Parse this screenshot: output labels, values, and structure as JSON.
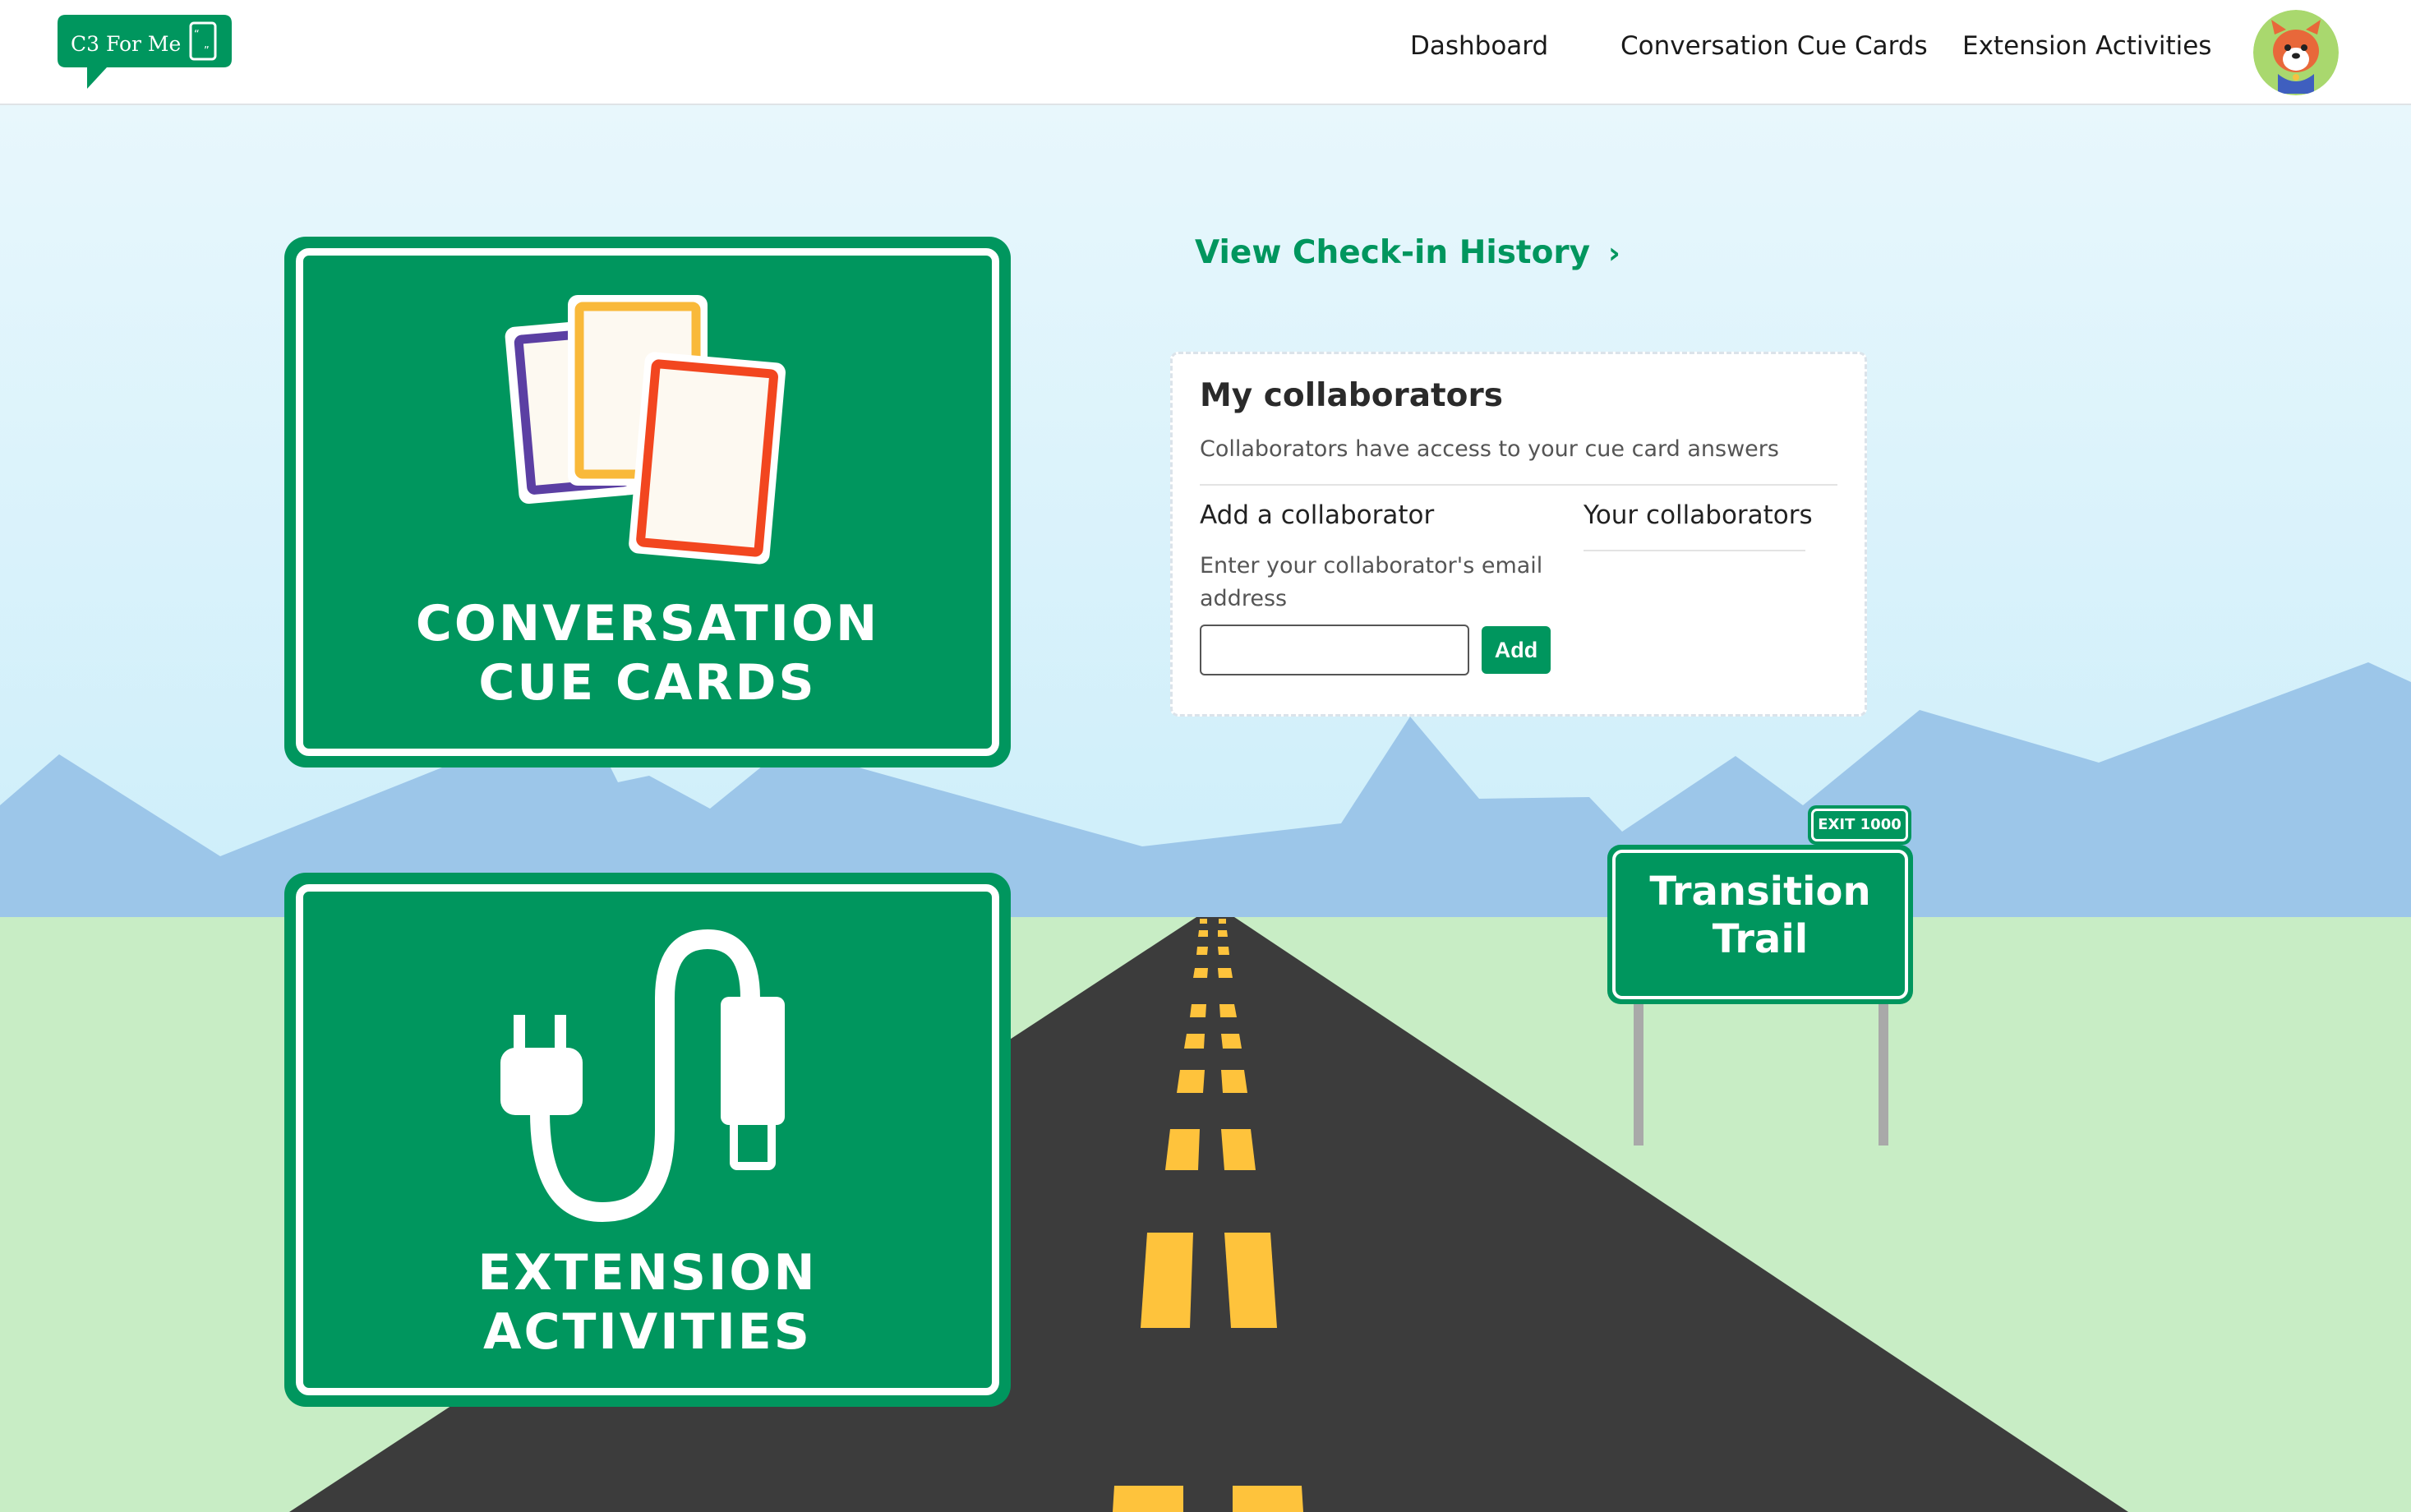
{
  "nav": {
    "logo_text": "C3 For Me",
    "links": [
      "Dashboard",
      "Conversation Cue Cards",
      "Extension Activities"
    ]
  },
  "signs": {
    "cue_cards": {
      "line1": "CONVERSATION",
      "line2": "CUE CARDS"
    },
    "extension": {
      "line1": "EXTENSION",
      "line2": "ACTIVITIES"
    }
  },
  "history_link": {
    "label": "View Check-in History",
    "chevron": "›"
  },
  "collaborators": {
    "title": "My collaborators",
    "subtitle": "Collaborators have access to your cue card answers",
    "add_heading": "Add a collaborator",
    "email_label": "Enter your collaborator's email address",
    "email_value": "",
    "add_button": "Add",
    "your_heading": "Your collaborators"
  },
  "trail": {
    "exit_label": "EXIT 1000",
    "line1": "Transition",
    "line2": "Trail"
  },
  "colors": {
    "brand_green": "#00965e",
    "sky": "#e3f4fb",
    "mountains": "#9cc6e9",
    "grass": "#c8edc5",
    "road": "#3c3c3c",
    "road_line": "#fec33c"
  }
}
